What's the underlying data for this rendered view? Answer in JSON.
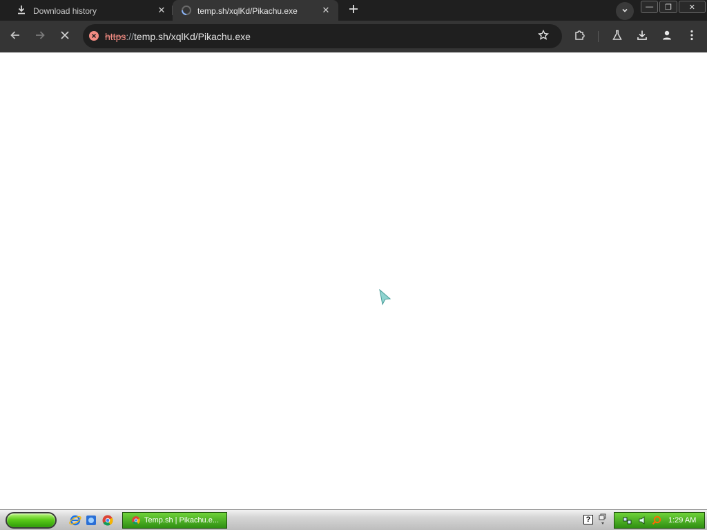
{
  "browser": {
    "tabs": [
      {
        "label": "Download history",
        "icon": "download-icon",
        "close_glyph": "✕"
      },
      {
        "label": "temp.sh/xqlKd/Pikachu.exe",
        "icon": "loading-spinner-icon",
        "close_glyph": "✕"
      }
    ],
    "new_tab_icon": "plus-icon",
    "tab_search_icon": "chevron-down-icon",
    "window_controls": {
      "minimize": "—",
      "restore": "❐",
      "close": "✕"
    },
    "toolbar": {
      "back_icon": "back-arrow-icon",
      "forward_icon": "forward-arrow-icon",
      "stop_icon": "stop-icon",
      "url_scheme": "https",
      "url_separator": "://",
      "url_rest": "temp.sh/xqlKd/Pikachu.exe",
      "right_icons": [
        "bookmark-star-icon",
        "extensions-icon",
        "labs-flask-icon",
        "downloads-icon",
        "profile-icon",
        "menu-kebab-icon"
      ]
    },
    "colors": {
      "dark_frame": "#1f1f1f",
      "toolbar": "#353535",
      "insecure_red": "#f28b82"
    }
  },
  "taskbar": {
    "quick_launch": [
      "internet-explorer-icon",
      "windows-explorer-icon",
      "chrome-icon"
    ],
    "task_label": "Temp.sh | Pikachu.e...",
    "help_glyph": "?",
    "clock": "1:29 AM",
    "colors": {
      "green": "#2f8f12",
      "start_green": "#5ccc1a"
    }
  }
}
